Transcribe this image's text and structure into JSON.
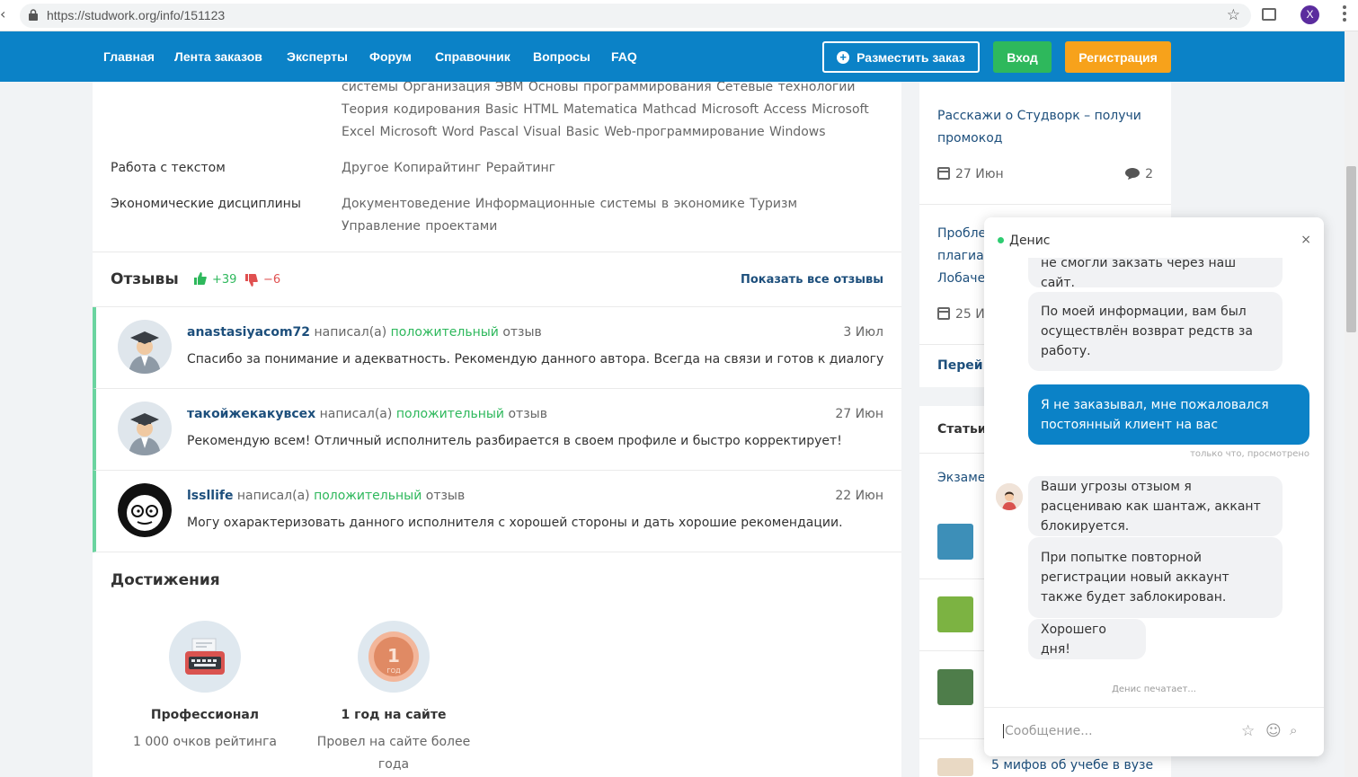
{
  "browser": {
    "url": "https://studwork.org/info/151123",
    "profile_initial": "X"
  },
  "nav": {
    "items": [
      "Главная",
      "Лента заказов",
      "Эксперты",
      "Форум",
      "Справочник",
      "Вопросы",
      "FAQ"
    ],
    "order_button": "Разместить заказ",
    "login_button": "Вход",
    "register_button": "Регистрация"
  },
  "skills": [
    {
      "label": "",
      "values": "системы  Организация ЭВМ  Основы программирования  Сетевые технологии  Теория кодирования  Basic  HTML  Matematica  Mathcad  Microsoft Access  Microsoft Excel  Microsoft Word  Pascal  Visual Basic  Web-программирование  Windows"
    },
    {
      "label": "Работа с текстом",
      "values": "Другое  Копирайтинг  Рерайтинг"
    },
    {
      "label": "Экономические дисциплины",
      "values": "Документоведение  Информационные системы в экономике  Туризм  Управление проектами"
    }
  ],
  "reviews": {
    "title": "Отзывы",
    "positive": "+39",
    "negative": "−6",
    "show_all": "Показать все отзывы",
    "wrote": "написал(а)",
    "kind_positive": "положительный",
    "review_word": "отзыв",
    "items": [
      {
        "author": "anastasiyacom72",
        "date": "3 Июл",
        "text": "Спасибо за понимание и адекватность. Рекомендую данного автора. Всегда на связи и готов к диалогу"
      },
      {
        "author": "такойжекакувсех",
        "date": "27 Июн",
        "text": "Рекомендую всем! Отличный исполнитель разбирается в своем профиле и быстро корректирует!"
      },
      {
        "author": "lssllife",
        "date": "22 Июн",
        "text": "Могу охарактеризовать данного исполнителя с хорошей стороны и дать хорошие рекомендации."
      }
    ]
  },
  "achievements": {
    "title": "Достижения",
    "items": [
      {
        "name": "Профессионал",
        "desc": "1 000 очков рейтинга"
      },
      {
        "name": "1 год на сайте",
        "desc": "Провел на сайте более года"
      }
    ]
  },
  "sidebar": {
    "post1": {
      "title": "Расскажи о Студворк – получи промокод",
      "date": "27 Июн",
      "comments": "2"
    },
    "post2": {
      "title": "Пробле плагиат Лобаче",
      "date": "25 И"
    },
    "more_link": "Перей",
    "articles_title": "Статьи",
    "article_first": "Экзаме",
    "article_last": "5 мифов об учебе в вузе"
  },
  "chat": {
    "agent": "Денис",
    "close": "×",
    "messages": [
      {
        "dir": "in",
        "text": "не смогли закзать через наш сайт."
      },
      {
        "dir": "in",
        "text": "По моей информации, вам был осуществлён возврат редств за работу."
      },
      {
        "dir": "out",
        "text": "Я не заказывал, мне пожаловался постоянный клиент на вас"
      },
      {
        "dir": "in",
        "text": "Ваши угрозы отзыом я расцениваю как шантаж, аккант блокируется."
      },
      {
        "dir": "in",
        "text": "При попытке повторной регистрации  новый аккаунт также будет заблокирован."
      },
      {
        "dir": "in",
        "text": "Хорошего дня!"
      }
    ],
    "seen": "только что, просмотрено",
    "typing": "Денис печатает...",
    "input_placeholder": "Сообщение..."
  },
  "colors": {
    "brand_blue": "#0b82c7",
    "green": "#2eb85c",
    "orange": "#f7a21b",
    "link": "#1d4f7c"
  }
}
